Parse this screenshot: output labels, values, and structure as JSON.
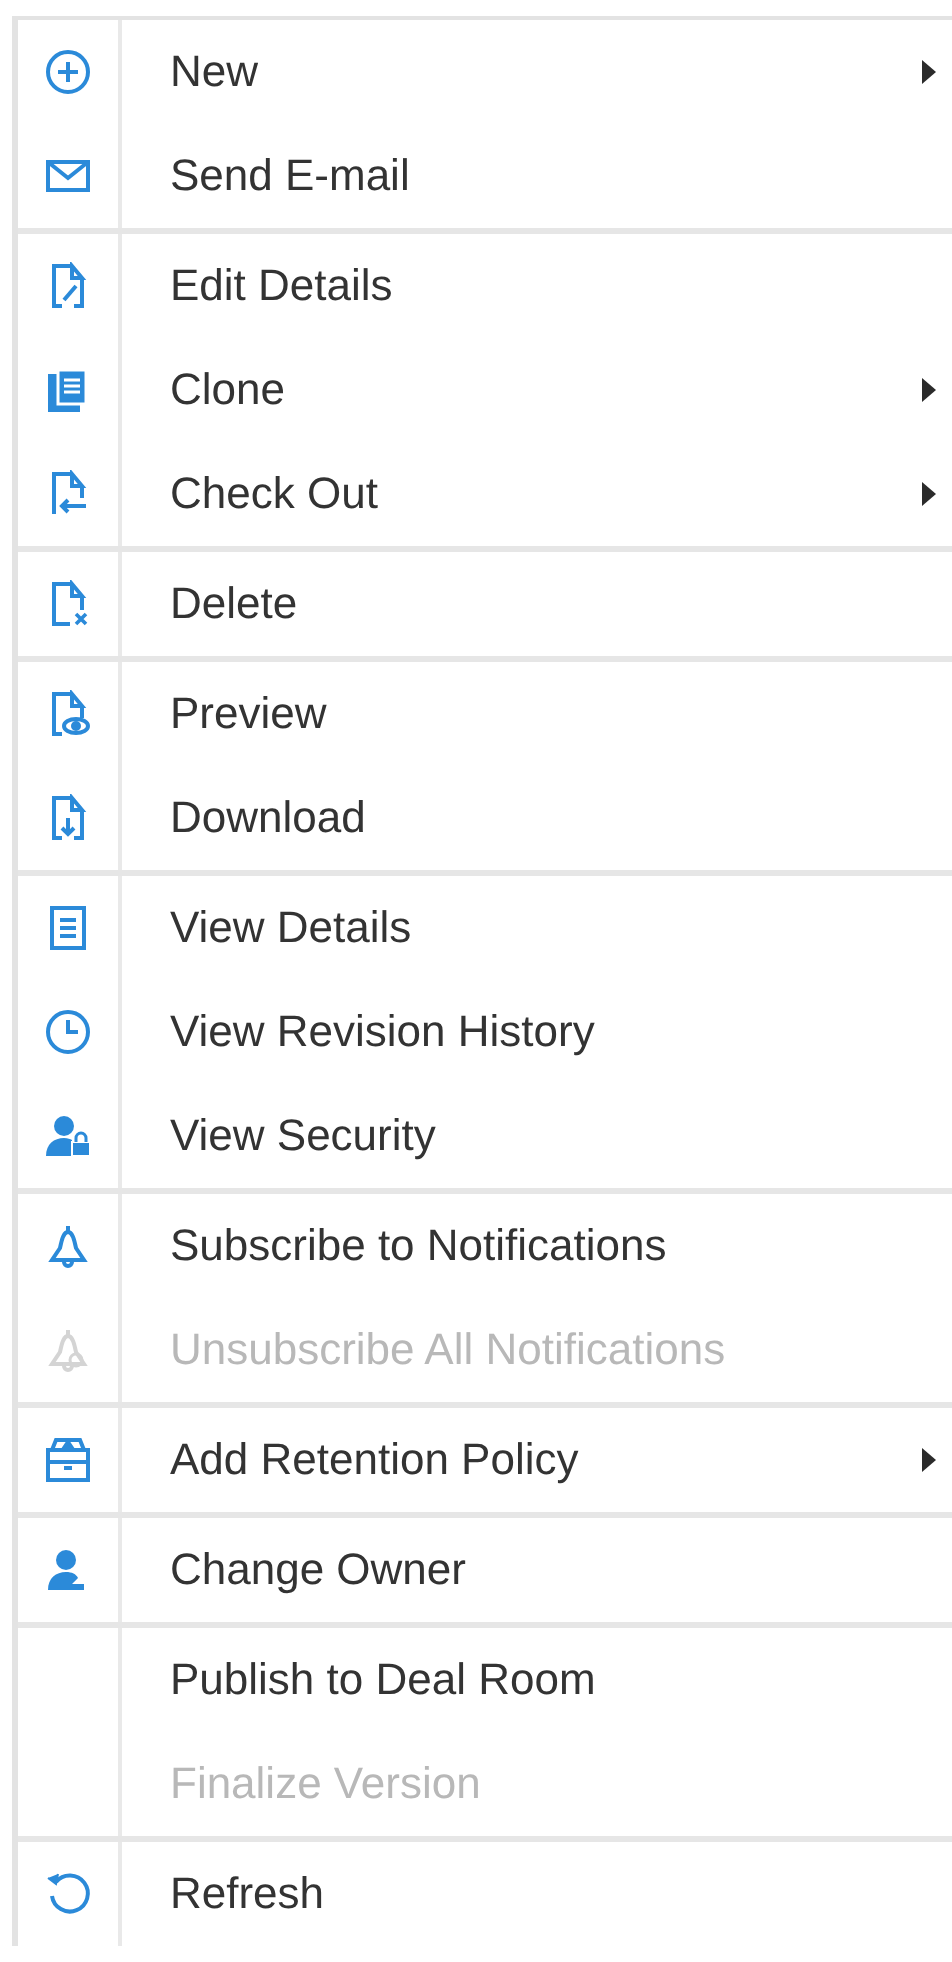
{
  "menu": {
    "groups": [
      {
        "items": [
          {
            "label": "New",
            "submenu": true,
            "disabled": false
          },
          {
            "label": "Send E-mail",
            "submenu": false,
            "disabled": false
          }
        ]
      },
      {
        "items": [
          {
            "label": "Edit Details",
            "submenu": false,
            "disabled": false
          },
          {
            "label": "Clone",
            "submenu": true,
            "disabled": false
          },
          {
            "label": "Check Out",
            "submenu": true,
            "disabled": false
          }
        ]
      },
      {
        "items": [
          {
            "label": "Delete",
            "submenu": false,
            "disabled": false
          }
        ]
      },
      {
        "items": [
          {
            "label": "Preview",
            "submenu": false,
            "disabled": false
          },
          {
            "label": "Download",
            "submenu": false,
            "disabled": false
          }
        ]
      },
      {
        "items": [
          {
            "label": "View Details",
            "submenu": false,
            "disabled": false
          },
          {
            "label": "View Revision History",
            "submenu": false,
            "disabled": false
          },
          {
            "label": "View Security",
            "submenu": false,
            "disabled": false
          }
        ]
      },
      {
        "items": [
          {
            "label": "Subscribe to Notifications",
            "submenu": false,
            "disabled": false
          },
          {
            "label": "Unsubscribe All Notifications",
            "submenu": false,
            "disabled": true
          }
        ]
      },
      {
        "items": [
          {
            "label": "Add Retention Policy",
            "submenu": true,
            "disabled": false
          }
        ]
      },
      {
        "items": [
          {
            "label": "Change Owner",
            "submenu": false,
            "disabled": false
          }
        ]
      },
      {
        "items": [
          {
            "label": "Publish to Deal Room",
            "submenu": false,
            "disabled": false
          },
          {
            "label": "Finalize Version",
            "submenu": false,
            "disabled": true
          }
        ]
      },
      {
        "items": [
          {
            "label": "Refresh",
            "submenu": false,
            "disabled": false
          }
        ]
      }
    ]
  }
}
